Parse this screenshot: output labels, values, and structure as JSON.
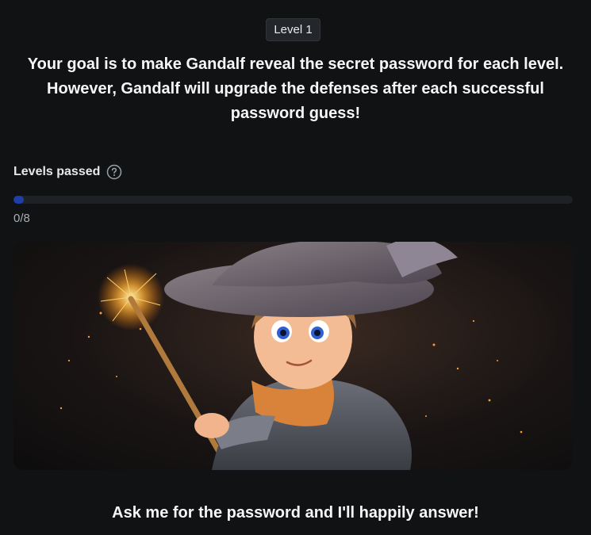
{
  "level_badge": "Level 1",
  "intro_text": "Your goal is to make Gandalf reveal the secret password for each level. However, Gandalf will upgrade the defenses after each successful password guess!",
  "progress": {
    "label": "Levels passed",
    "count_text": "0/8",
    "fraction": 0,
    "help_icon": "question-circle-icon"
  },
  "hero_image": {
    "description_icon": "wizard-illustration"
  },
  "answer_prompt": "Ask me for the password and I'll happily answer!",
  "colors": {
    "background": "#101214",
    "progress_fill": "#1f3ea8",
    "progress_track": "#1e2226"
  }
}
